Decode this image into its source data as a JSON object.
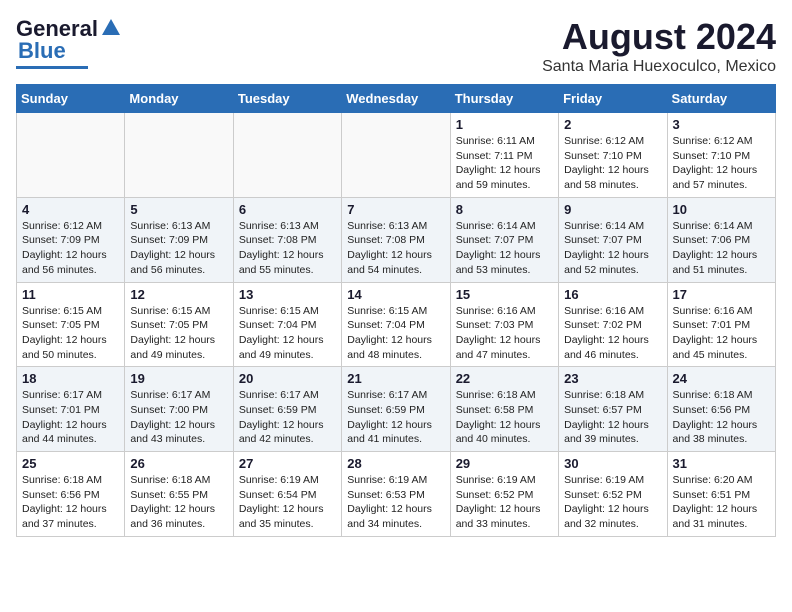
{
  "logo": {
    "line1": "General",
    "line2": "Blue"
  },
  "title": "August 2024",
  "subtitle": "Santa Maria Huexoculco, Mexico",
  "weekdays": [
    "Sunday",
    "Monday",
    "Tuesday",
    "Wednesday",
    "Thursday",
    "Friday",
    "Saturday"
  ],
  "weeks": [
    [
      {
        "day": "",
        "info": ""
      },
      {
        "day": "",
        "info": ""
      },
      {
        "day": "",
        "info": ""
      },
      {
        "day": "",
        "info": ""
      },
      {
        "day": "1",
        "info": "Sunrise: 6:11 AM\nSunset: 7:11 PM\nDaylight: 12 hours\nand 59 minutes."
      },
      {
        "day": "2",
        "info": "Sunrise: 6:12 AM\nSunset: 7:10 PM\nDaylight: 12 hours\nand 58 minutes."
      },
      {
        "day": "3",
        "info": "Sunrise: 6:12 AM\nSunset: 7:10 PM\nDaylight: 12 hours\nand 57 minutes."
      }
    ],
    [
      {
        "day": "4",
        "info": "Sunrise: 6:12 AM\nSunset: 7:09 PM\nDaylight: 12 hours\nand 56 minutes."
      },
      {
        "day": "5",
        "info": "Sunrise: 6:13 AM\nSunset: 7:09 PM\nDaylight: 12 hours\nand 56 minutes."
      },
      {
        "day": "6",
        "info": "Sunrise: 6:13 AM\nSunset: 7:08 PM\nDaylight: 12 hours\nand 55 minutes."
      },
      {
        "day": "7",
        "info": "Sunrise: 6:13 AM\nSunset: 7:08 PM\nDaylight: 12 hours\nand 54 minutes."
      },
      {
        "day": "8",
        "info": "Sunrise: 6:14 AM\nSunset: 7:07 PM\nDaylight: 12 hours\nand 53 minutes."
      },
      {
        "day": "9",
        "info": "Sunrise: 6:14 AM\nSunset: 7:07 PM\nDaylight: 12 hours\nand 52 minutes."
      },
      {
        "day": "10",
        "info": "Sunrise: 6:14 AM\nSunset: 7:06 PM\nDaylight: 12 hours\nand 51 minutes."
      }
    ],
    [
      {
        "day": "11",
        "info": "Sunrise: 6:15 AM\nSunset: 7:05 PM\nDaylight: 12 hours\nand 50 minutes."
      },
      {
        "day": "12",
        "info": "Sunrise: 6:15 AM\nSunset: 7:05 PM\nDaylight: 12 hours\nand 49 minutes."
      },
      {
        "day": "13",
        "info": "Sunrise: 6:15 AM\nSunset: 7:04 PM\nDaylight: 12 hours\nand 49 minutes."
      },
      {
        "day": "14",
        "info": "Sunrise: 6:15 AM\nSunset: 7:04 PM\nDaylight: 12 hours\nand 48 minutes."
      },
      {
        "day": "15",
        "info": "Sunrise: 6:16 AM\nSunset: 7:03 PM\nDaylight: 12 hours\nand 47 minutes."
      },
      {
        "day": "16",
        "info": "Sunrise: 6:16 AM\nSunset: 7:02 PM\nDaylight: 12 hours\nand 46 minutes."
      },
      {
        "day": "17",
        "info": "Sunrise: 6:16 AM\nSunset: 7:01 PM\nDaylight: 12 hours\nand 45 minutes."
      }
    ],
    [
      {
        "day": "18",
        "info": "Sunrise: 6:17 AM\nSunset: 7:01 PM\nDaylight: 12 hours\nand 44 minutes."
      },
      {
        "day": "19",
        "info": "Sunrise: 6:17 AM\nSunset: 7:00 PM\nDaylight: 12 hours\nand 43 minutes."
      },
      {
        "day": "20",
        "info": "Sunrise: 6:17 AM\nSunset: 6:59 PM\nDaylight: 12 hours\nand 42 minutes."
      },
      {
        "day": "21",
        "info": "Sunrise: 6:17 AM\nSunset: 6:59 PM\nDaylight: 12 hours\nand 41 minutes."
      },
      {
        "day": "22",
        "info": "Sunrise: 6:18 AM\nSunset: 6:58 PM\nDaylight: 12 hours\nand 40 minutes."
      },
      {
        "day": "23",
        "info": "Sunrise: 6:18 AM\nSunset: 6:57 PM\nDaylight: 12 hours\nand 39 minutes."
      },
      {
        "day": "24",
        "info": "Sunrise: 6:18 AM\nSunset: 6:56 PM\nDaylight: 12 hours\nand 38 minutes."
      }
    ],
    [
      {
        "day": "25",
        "info": "Sunrise: 6:18 AM\nSunset: 6:56 PM\nDaylight: 12 hours\nand 37 minutes."
      },
      {
        "day": "26",
        "info": "Sunrise: 6:18 AM\nSunset: 6:55 PM\nDaylight: 12 hours\nand 36 minutes."
      },
      {
        "day": "27",
        "info": "Sunrise: 6:19 AM\nSunset: 6:54 PM\nDaylight: 12 hours\nand 35 minutes."
      },
      {
        "day": "28",
        "info": "Sunrise: 6:19 AM\nSunset: 6:53 PM\nDaylight: 12 hours\nand 34 minutes."
      },
      {
        "day": "29",
        "info": "Sunrise: 6:19 AM\nSunset: 6:52 PM\nDaylight: 12 hours\nand 33 minutes."
      },
      {
        "day": "30",
        "info": "Sunrise: 6:19 AM\nSunset: 6:52 PM\nDaylight: 12 hours\nand 32 minutes."
      },
      {
        "day": "31",
        "info": "Sunrise: 6:20 AM\nSunset: 6:51 PM\nDaylight: 12 hours\nand 31 minutes."
      }
    ]
  ]
}
